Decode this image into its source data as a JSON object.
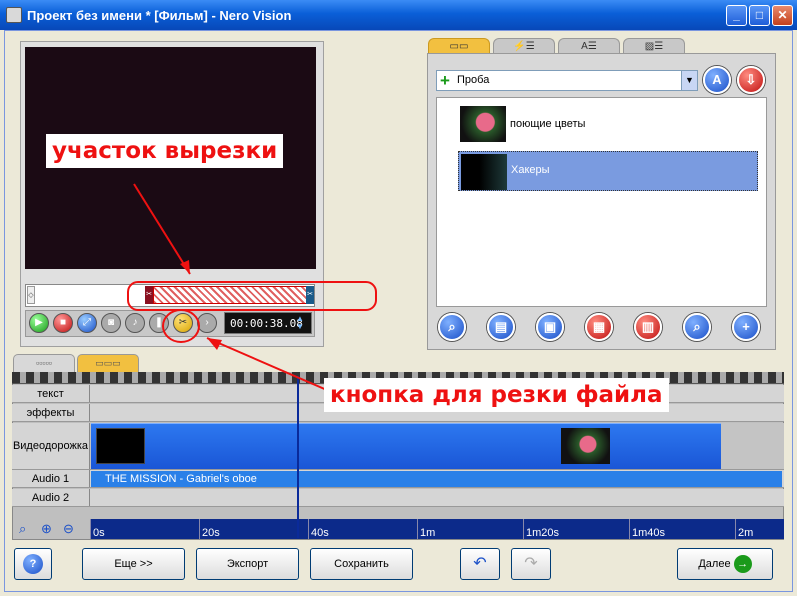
{
  "window": {
    "title": "Проект без имени * [Фильм] - Nero Vision",
    "minimize": "_",
    "maximize": "□",
    "close": "✕"
  },
  "preview": {
    "timecode": "00:00:38.08"
  },
  "project_select": {
    "value": "Проба"
  },
  "files": [
    {
      "label": "поющие цветы"
    },
    {
      "label": "Хакеры"
    }
  ],
  "tracks": [
    {
      "label": "текст"
    },
    {
      "label": "эффекты"
    },
    {
      "label": "Видеодорожка"
    },
    {
      "label": "Audio 1"
    },
    {
      "label": "Audio 2"
    }
  ],
  "audio_clip": {
    "label": "THE MISSION - Gabriel's oboe"
  },
  "ruler": [
    "0s",
    "20s",
    "40s",
    "1m",
    "1m20s",
    "1m40s",
    "2m"
  ],
  "bottom": {
    "more": "Еще >>",
    "export": "Экспорт",
    "save": "Сохранить",
    "next": "Далее",
    "help": "?"
  },
  "annotations": {
    "cut_area": "участок вырезки",
    "cut_button": "кнопка для резки файла"
  },
  "colors": {
    "accent": "#1a56d6",
    "annotation": "#ee1111"
  }
}
